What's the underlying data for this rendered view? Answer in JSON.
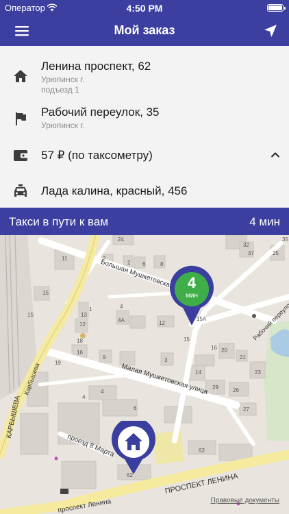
{
  "status_bar": {
    "carrier": "Оператор",
    "time": "4:50 PM"
  },
  "nav": {
    "title": "Мой заказ"
  },
  "order": {
    "pickup": {
      "address": "Ленина проспект, 62",
      "city": "Урюпинск г.",
      "note": "подъезд 1"
    },
    "destination": {
      "address": "Рабочий переулок, 35",
      "city": "Урюпинск г."
    },
    "payment": {
      "text": "57 ₽ (по таксометру)"
    },
    "car": {
      "text": "Лада калина, красный, 456"
    }
  },
  "banner": {
    "status": "Такси в пути к вам",
    "eta": "4 мин"
  },
  "map": {
    "eta_marker": {
      "value": "4",
      "unit": "мин"
    },
    "streets": {
      "bolshaya": "Большая Мушкетовская у",
      "malaya": "Малая Мушкетовская улица",
      "prospekt": "ПРОСПЕКТ ЛЕНИНА",
      "prospekt_lower": "проспект Ленина",
      "marta": "проезд 8 Марта",
      "karbysheva": "КАРБЫШЕВА",
      "karbysheva_small": "Карбышева",
      "rabochiy": "Рабочий переулок"
    },
    "house_numbers": [
      "24",
      "11",
      "15",
      "2",
      "1",
      "4",
      "4А",
      "2",
      "6",
      "8",
      "12",
      "13",
      "18",
      "16",
      "15",
      "19",
      "9",
      "3",
      "4",
      "6",
      "12",
      "15А",
      "15",
      "14",
      "16",
      "20",
      "21",
      "23",
      "25",
      "26",
      "27",
      "29",
      "32",
      "35",
      "37",
      "62",
      "4",
      "62"
    ],
    "docs_link": "Правовые документы",
    "colors": {
      "pin_blue": "#3a3e9e",
      "eta_green": "#3fae49"
    }
  }
}
